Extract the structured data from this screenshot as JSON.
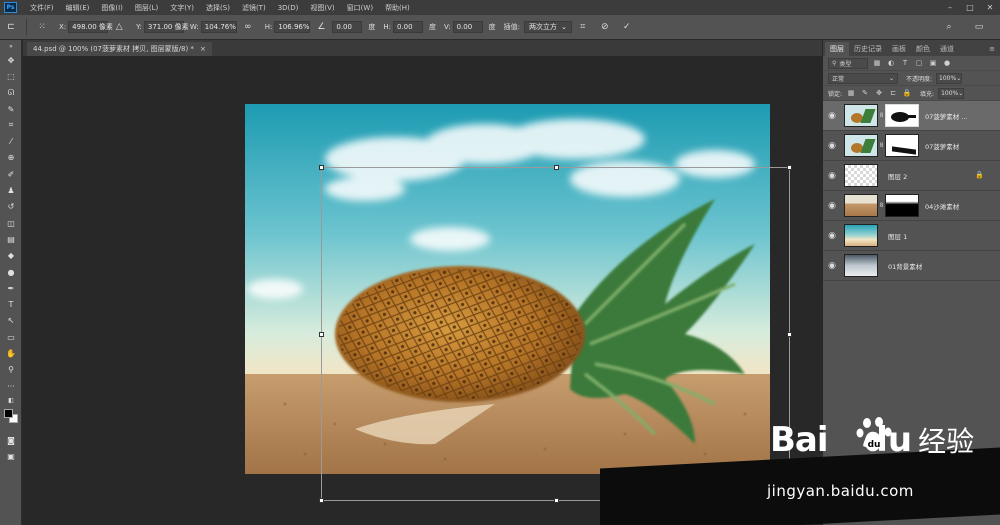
{
  "menubar": {
    "logo": "Ps",
    "items": [
      "文件(F)",
      "编辑(E)",
      "图像(I)",
      "图层(L)",
      "文字(Y)",
      "选择(S)",
      "滤镜(T)",
      "3D(D)",
      "视图(V)",
      "窗口(W)",
      "帮助(H)"
    ]
  },
  "options": {
    "x_label": "X:",
    "x_value": "498.00 像素",
    "y_label": "Y:",
    "y_value": "371.00 像素",
    "w_label": "W:",
    "w_value": "104.76%",
    "h_label": "H:",
    "h_value": "106.96%",
    "angle_value": "0.00",
    "angle_unit": "度",
    "hskew_label": "H:",
    "hskew_value": "0.00",
    "hskew_unit": "度",
    "vskew_label": "V:",
    "vskew_value": "0.00",
    "vskew_unit": "度",
    "interp_label": "插值:",
    "interp_value": "两次立方"
  },
  "document": {
    "tab_title": "44.psd @ 100% (07菠萝素材 拷贝, 图层蒙版/8) *"
  },
  "panels": {
    "tabs": [
      "图层",
      "历史记录",
      "画板",
      "颜色",
      "通道"
    ],
    "active_tab": "图层",
    "kind_label": "类型",
    "blend_mode": "正常",
    "opacity_label": "不透明度:",
    "opacity_value": "100%",
    "lock_label": "锁定:",
    "fill_label": "填充:",
    "fill_value": "100%",
    "layers": [
      {
        "name": "07菠萝素材 ...",
        "selected": true
      },
      {
        "name": "07菠萝素材",
        "selected": false
      },
      {
        "name": "图层 2",
        "selected": false
      },
      {
        "name": "04沙滩素材",
        "selected": false
      },
      {
        "name": "图层 1",
        "selected": false
      },
      {
        "name": "01背景素材",
        "selected": false
      }
    ]
  },
  "watermark": {
    "bai": "Bai",
    "du": "du",
    "cn": "经验",
    "url": "jingyan.baidu.com"
  },
  "colors": {
    "accent": "#2f8ad8",
    "panel_bg": "#535353",
    "canvas_bg": "#282828",
    "selected_layer": "#6a6a6a"
  }
}
